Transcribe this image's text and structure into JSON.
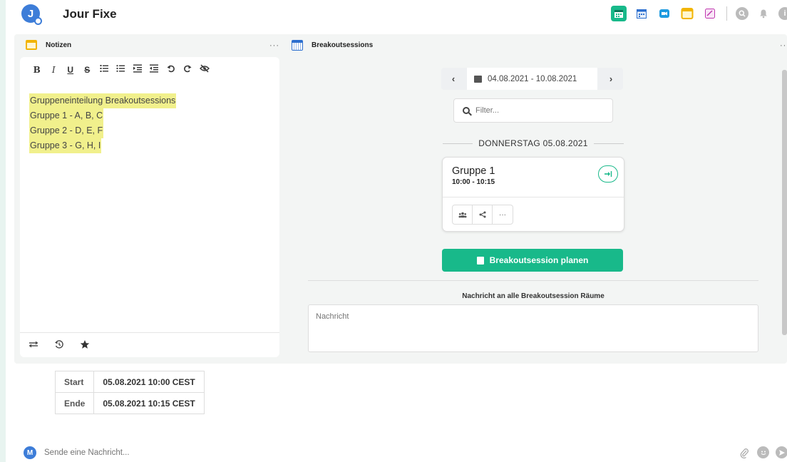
{
  "header": {
    "avatar_letter": "J",
    "room_title": "Jour Fixe",
    "colors": {
      "accent_green": "#18b98a",
      "avatar_blue": "#3d7dd8"
    }
  },
  "notes": {
    "title": "Notizen",
    "menu": "···",
    "toolbar": [
      "B",
      "I",
      "U",
      "S"
    ],
    "lines": [
      "Gruppeneinteilung Breakoutsessions",
      "Gruppe 1 - A, B, C",
      "Gruppe 2 - D, E, F",
      "Gruppe 3 - G, H, I"
    ]
  },
  "breakout": {
    "title": "Breakoutsessions",
    "menu": "···",
    "date_range": "04.08.2021 - 10.08.2021",
    "filter_placeholder": "Filter...",
    "day_label": "DONNERSTAG 05.08.2021",
    "session": {
      "name": "Gruppe 1",
      "time": "10:00 - 10:15",
      "more": "···"
    },
    "plan_button": "Breakoutsession planen",
    "message_label": "Nachricht an alle Breakoutsession Räume",
    "message_placeholder": "Nachricht"
  },
  "times": [
    {
      "label": "Start",
      "value": "05.08.2021 10:00 CEST"
    },
    {
      "label": "Ende",
      "value": "05.08.2021 10:15 CEST"
    }
  ],
  "composer": {
    "avatar_letter": "M",
    "placeholder": "Sende eine Nachricht..."
  }
}
